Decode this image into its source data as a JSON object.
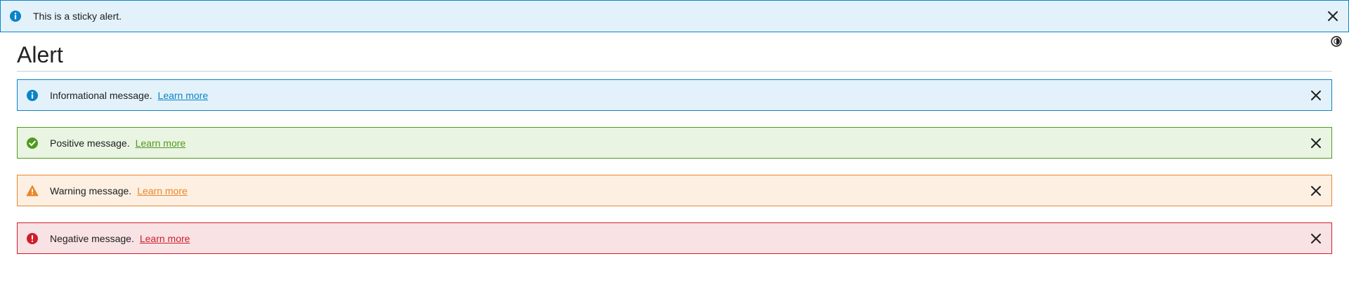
{
  "sticky_alert": {
    "message": "This is a sticky alert.",
    "icon": "info-icon",
    "accent": "#0a84c6",
    "background": "#e3f2fa"
  },
  "page": {
    "title": "Alert",
    "theme_toggle_icon": "contrast-icon"
  },
  "alerts": [
    {
      "kind": "informational",
      "message": "Informational message.",
      "link": "Learn more",
      "icon": "info-icon",
      "accent": "#0a84c6",
      "background": "#e3f2fa"
    },
    {
      "kind": "positive",
      "message": "Positive message.",
      "link": "Learn more",
      "icon": "check-circle-icon",
      "accent": "#4f9a1e",
      "background": "#eaf4e2"
    },
    {
      "kind": "warning",
      "message": "Warning message.",
      "link": "Learn more",
      "icon": "warning-triangle-icon",
      "accent": "#e8872b",
      "background": "#fdf0e3"
    },
    {
      "kind": "negative",
      "message": "Negative message.",
      "link": "Learn more",
      "icon": "error-icon",
      "accent": "#cc1f2c",
      "background": "#f9e2e4"
    }
  ],
  "close_icon": "close-icon"
}
